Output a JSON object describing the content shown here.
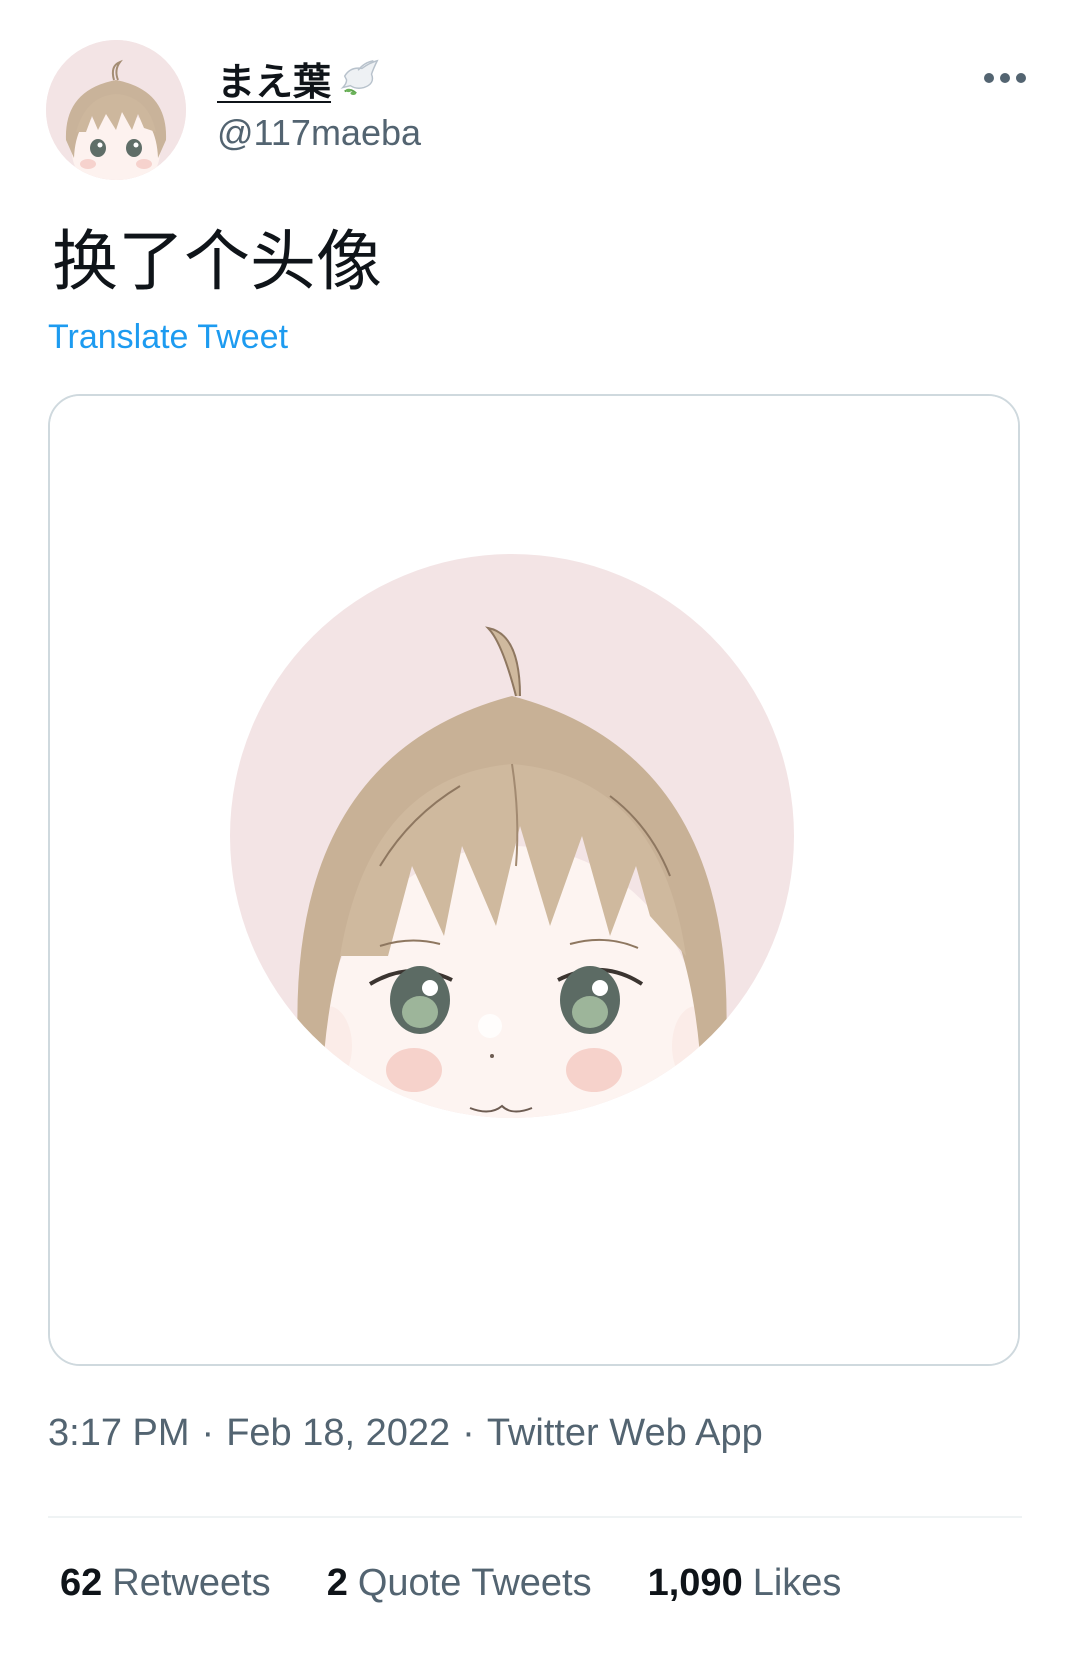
{
  "author": {
    "display_name": "まえ葉",
    "handle": "@117maeba",
    "badge_icon": "dove-emoji-icon"
  },
  "tweet": {
    "text": "换了个头像",
    "translate_label": "Translate Tweet",
    "media_alt_icon": "anime-avatar-image"
  },
  "meta": {
    "time": "3:17 PM",
    "date": "Feb 18, 2022",
    "source": "Twitter Web App",
    "separator": "·"
  },
  "stats": {
    "retweets_count": "62",
    "retweets_label": "Retweets",
    "quotes_count": "2",
    "quotes_label": "Quote Tweets",
    "likes_count": "1,090",
    "likes_label": "Likes"
  },
  "colors": {
    "accent": "#1d9bf0",
    "secondary_text": "#536471",
    "avatar_bg": "#f3e4e5",
    "hair": "#c9b39a",
    "eye": "#5f6e68"
  }
}
